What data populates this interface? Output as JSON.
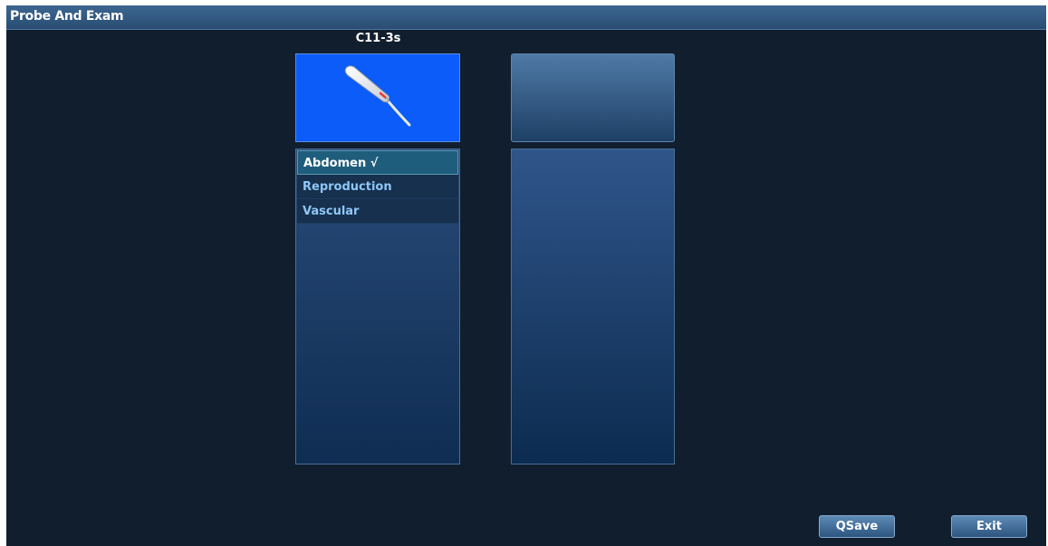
{
  "window": {
    "title": "Probe And Exam"
  },
  "probe": {
    "name": "C11-3s",
    "icon": "linear-probe-icon"
  },
  "exams": {
    "items": [
      {
        "label": "Abdomen  √",
        "selected": true
      },
      {
        "label": "Reproduction",
        "selected": false
      },
      {
        "label": "Vascular",
        "selected": false
      }
    ]
  },
  "buttons": {
    "qsave": "QSave",
    "exit": "Exit"
  },
  "colors": {
    "background": "#111e2e",
    "probe_tile": "#0b5cf8",
    "selected_item": "#1f5d7c",
    "item_text": "#8fc6f5"
  }
}
